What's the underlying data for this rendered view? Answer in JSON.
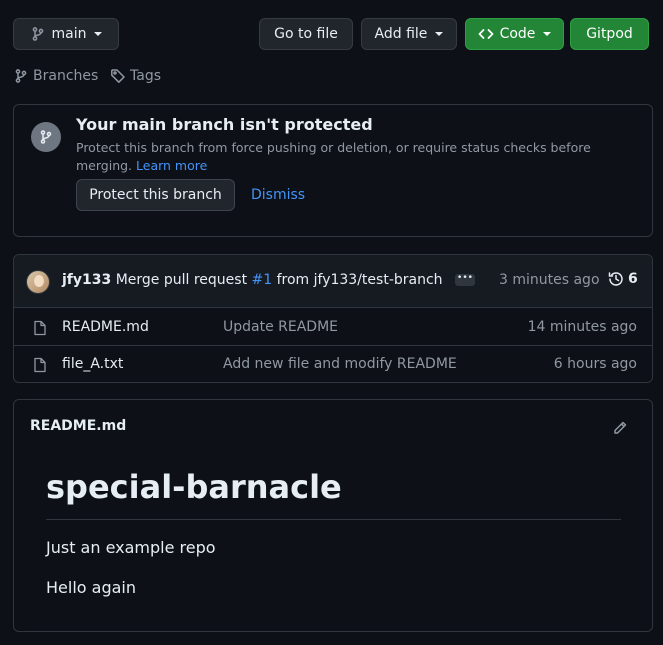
{
  "toolbar": {
    "branch_label": "main",
    "go_to_file": "Go to file",
    "add_file": "Add file",
    "code": "Code",
    "gitpod": "Gitpod"
  },
  "meta_links": {
    "branches": "Branches",
    "tags": "Tags"
  },
  "protection_banner": {
    "title": "Your main branch isn't protected",
    "description": "Protect this branch from force pushing or deletion, or require status checks before merging.",
    "learn_more": "Learn more",
    "protect_button": "Protect this branch",
    "dismiss": "Dismiss"
  },
  "latest_commit": {
    "author": "jfy133",
    "message_prefix": "Merge pull request",
    "pr_ref": "#1",
    "message_suffix": "from jfy133/test-branch",
    "time": "3 minutes ago",
    "commit_count": "6"
  },
  "files": [
    {
      "name": "README.md",
      "message": "Update README",
      "time": "14 minutes ago"
    },
    {
      "name": "file_A.txt",
      "message": "Add new file and modify README",
      "time": "6 hours ago"
    }
  ],
  "readme": {
    "label": "README.md",
    "heading": "special-barnacle",
    "paragraph1": "Just an example repo",
    "paragraph2": "Hello again"
  },
  "colors": {
    "background": "#0d1117",
    "border": "#30363d",
    "accent_green": "#238636",
    "link_blue": "#4493f8",
    "muted_text": "#9198a1"
  }
}
